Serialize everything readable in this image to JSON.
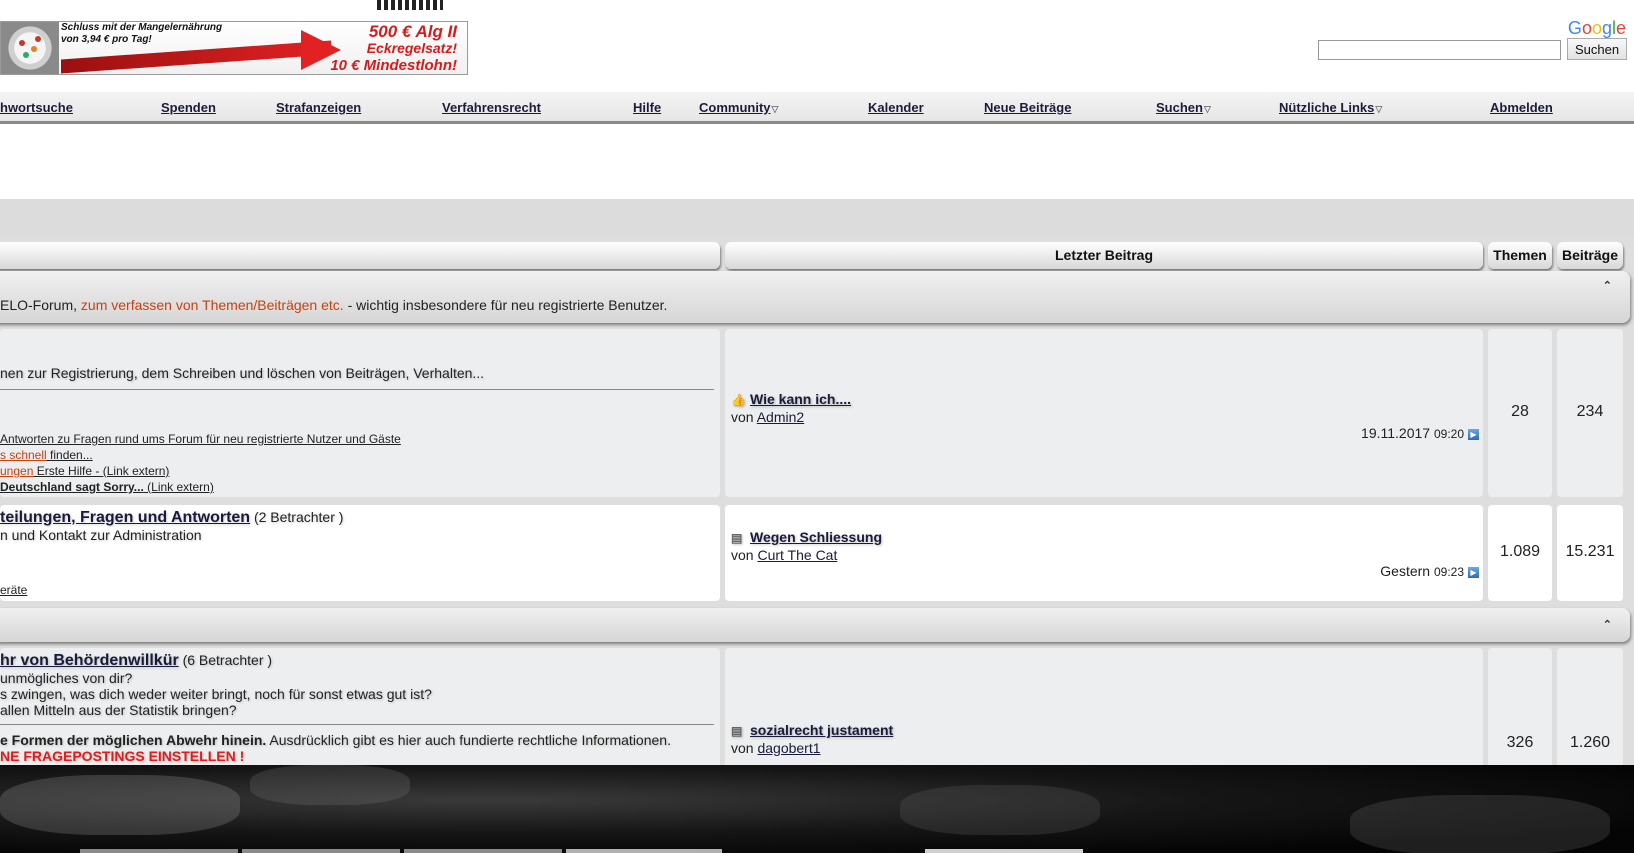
{
  "banner": {
    "small_line1": "Schluss mit der Mangelernährung",
    "small_line2": "von 3,94 € pro Tag!",
    "big_line1": "500 € Alg II",
    "big_line2": "Eckregelsatz!",
    "big_line3": "10 € Mindestlohn!"
  },
  "search": {
    "logo": [
      "G",
      "o",
      "o",
      "g",
      "l",
      "e"
    ],
    "button_label": "Suchen",
    "placeholder": ""
  },
  "nav": {
    "items": [
      {
        "label": "hwortsuche"
      },
      {
        "label": "Spenden"
      },
      {
        "label": "Strafanzeigen"
      },
      {
        "label": "Verfahrensrecht"
      },
      {
        "label": "Hilfe"
      },
      {
        "label": "Community",
        "dropdown": true
      },
      {
        "label": "Kalender"
      },
      {
        "label": "Neue Beiträge"
      },
      {
        "label": "Suchen",
        "dropdown": true
      },
      {
        "label": "Nützliche Links",
        "dropdown": true
      },
      {
        "label": "Abmelden"
      }
    ],
    "caret": "▽"
  },
  "table_header": {
    "last_post": "Letzter Beitrag",
    "topics": "Themen",
    "posts": "Beiträge"
  },
  "category1": {
    "desc_prefix": "ELO-Forum, ",
    "desc_link": "zum verfassen von Themen/Beiträgen etc.",
    "desc_suffix": " - wichtig insbesondere für neu registrierte Benutzer.",
    "collapse": "⌃"
  },
  "forum1": {
    "desc": "nen zur Registrierung, dem Schreiben und löschen von Beiträgen, Verhalten...",
    "link1": "Antworten zu Fragen rund ums Forum für neu registrierte Nutzer und Gäste",
    "link2_orange": "s schnell",
    "link2_rest": " finden...",
    "link3_orange": "ungen",
    "link3_rest": " Erste Hilfe - ",
    "link3_ext": "(Link extern)",
    "link4_bold": "Deutschland sagt Sorry...",
    "link4_ext": " (Link extern)",
    "last_post_title": "Wie kann ich....",
    "last_post_by_label": "von",
    "last_post_by": "Admin2",
    "last_post_date": "19.11.2017",
    "last_post_time": "09:20",
    "topics": "28",
    "posts": "234"
  },
  "forum2": {
    "title": "teilungen, Fragen und Antworten",
    "viewers": " (2 Betrachter )",
    "desc": "n und Kontakt zur Administration",
    "sub": "eräte",
    "last_post_title": "Wegen Schliessung",
    "last_post_by_label": "von",
    "last_post_by": "Curt The Cat",
    "last_post_date": "Gestern",
    "last_post_time": "09:23",
    "topics": "1.089",
    "posts": "15.231"
  },
  "category2": {
    "collapse": "⌃"
  },
  "forum3": {
    "title": "hr von Behördenwillkür",
    "viewers": " (6 Betrachter )",
    "line1": " unmögliches von dir?",
    "line2": "s zwingen, was dich weder weiter bringt, noch für sonst etwas gut ist?",
    "line3": "allen Mitteln aus der Statistik bringen?",
    "bold": "e Formen der möglichen Abwehr hinein.",
    "rest": " Ausdrücklich gibt es hier auch fundierte rechtliche Informationen.",
    "red": "NE FRAGEPOSTINGS EINSTELLEN !",
    "last_post_title": "sozialrecht justament",
    "last_post_by_label": "von",
    "last_post_by": "dagobert1",
    "topics": "326",
    "posts": "1.260"
  },
  "colors": {
    "accent_orange": "#c8410f",
    "link_dark": "#1a1a3a",
    "warning_red": "#e41b1b"
  }
}
